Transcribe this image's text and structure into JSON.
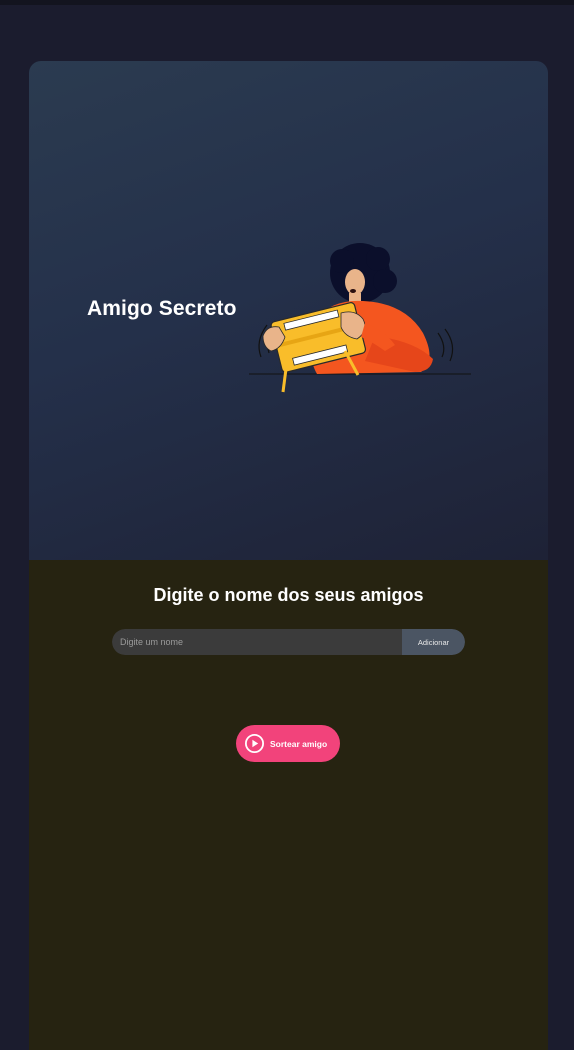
{
  "header": {
    "title": "Amigo Secreto"
  },
  "main": {
    "subtitle": "Digite o nome dos seus amigos",
    "name_input": {
      "placeholder": "Digite um nome",
      "value": ""
    },
    "add_button_label": "Adicionar",
    "draw_button_label": "Sortear amigo"
  },
  "icons": {
    "illustration": "person-holding-gift-illustration",
    "draw": "play-circle-icon"
  },
  "colors": {
    "background": "#1b1c2e",
    "header_gradient_start": "#2b3b50",
    "body_background": "#262311",
    "input_background": "#3b3b3b",
    "add_button": "#4b5563",
    "draw_button": "#f2437b"
  }
}
